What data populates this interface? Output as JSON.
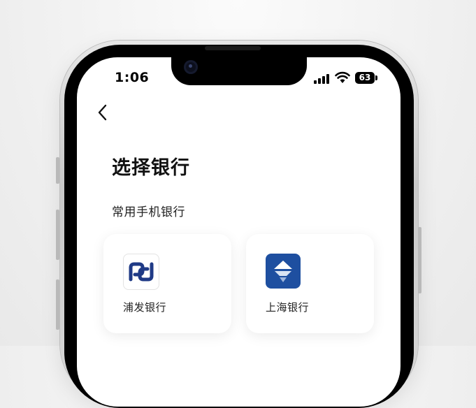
{
  "status_bar": {
    "time": "1:06",
    "battery": "63"
  },
  "header": {
    "back_icon": "chevron-left-icon",
    "title": "选择银行"
  },
  "section": {
    "label": "常用手机银行"
  },
  "banks": [
    {
      "name": "浦发银行",
      "logo_icon": "spdb-logo-icon",
      "color": "#1f3a86"
    },
    {
      "name": "上海银行",
      "logo_icon": "bank-of-shanghai-logo-icon",
      "color": "#1e4fa0"
    }
  ]
}
